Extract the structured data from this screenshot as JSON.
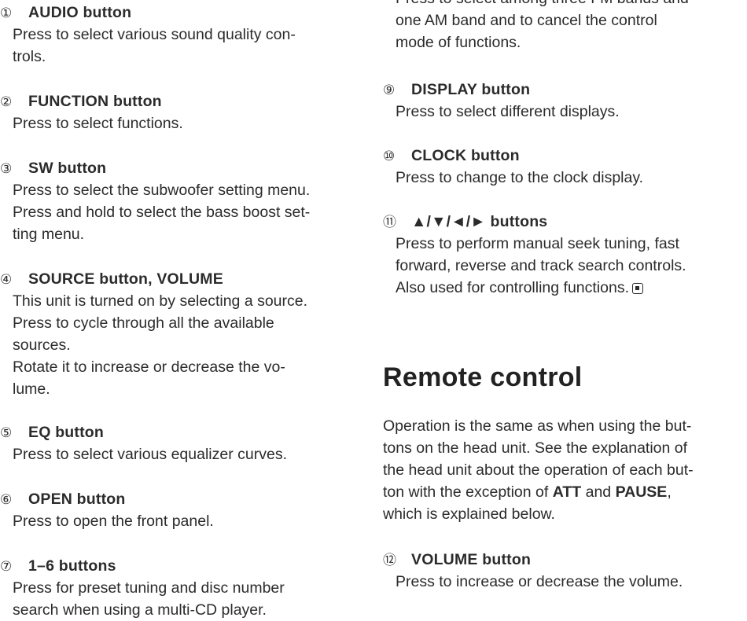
{
  "left_items": [
    {
      "num": "①",
      "label": "AUDIO button",
      "lines": [
        "Press to select various sound quality con-",
        "trols."
      ]
    },
    {
      "num": "②",
      "label": "FUNCTION button",
      "lines": [
        "Press to select functions."
      ]
    },
    {
      "num": "③",
      "label": "SW button",
      "lines": [
        "Press to select the subwoofer setting menu.",
        "Press and hold to select the bass boost set-",
        "ting menu."
      ]
    },
    {
      "num": "④",
      "label": "SOURCE button, VOLUME",
      "lines": [
        "This unit is turned on by selecting a source.",
        "Press to cycle through all the available",
        "sources.",
        "Rotate it to increase or decrease the vo-",
        "lume."
      ]
    },
    {
      "num": "⑤",
      "label": "EQ button",
      "lines": [
        "Press to select various equalizer curves."
      ]
    },
    {
      "num": "⑥",
      "label": "OPEN button",
      "lines": [
        "Press to open the front panel."
      ]
    },
    {
      "num": "⑦",
      "label": "1–6 buttons",
      "lines": [
        "Press for preset tuning and disc number",
        "search when using a multi-CD player."
      ]
    }
  ],
  "right_top_lines": [
    "Press to select among three FM bands and",
    "one AM band and to cancel the control",
    "mode of functions."
  ],
  "right_items": [
    {
      "num": "⑨",
      "label": "DISPLAY button",
      "lines": [
        "Press to select different displays."
      ]
    },
    {
      "num": "⑩",
      "label": "CLOCK button",
      "lines": [
        "Press to change to the clock display."
      ]
    },
    {
      "num": "⑪",
      "label": "▲/▼/◄/► buttons",
      "lines": [
        "Press to perform manual seek tuning, fast",
        "forward, reverse and track search controls.",
        "Also used for controlling functions."
      ]
    }
  ],
  "section_title": "Remote control",
  "paragraph": {
    "line1": "Operation is the same as when using the but-",
    "line2": "tons on the head unit. See the explanation of",
    "line3": "the head unit about the operation of each but-",
    "line4_pre": "ton with the exception of ",
    "line4_b1": "ATT",
    "line4_mid": " and ",
    "line4_b2": "PAUSE",
    "line4_post": ",",
    "line5": "which is explained below."
  },
  "volume_item": {
    "num": "⑫",
    "label": "VOLUME button",
    "lines": [
      "Press to increase or decrease the volume."
    ]
  }
}
